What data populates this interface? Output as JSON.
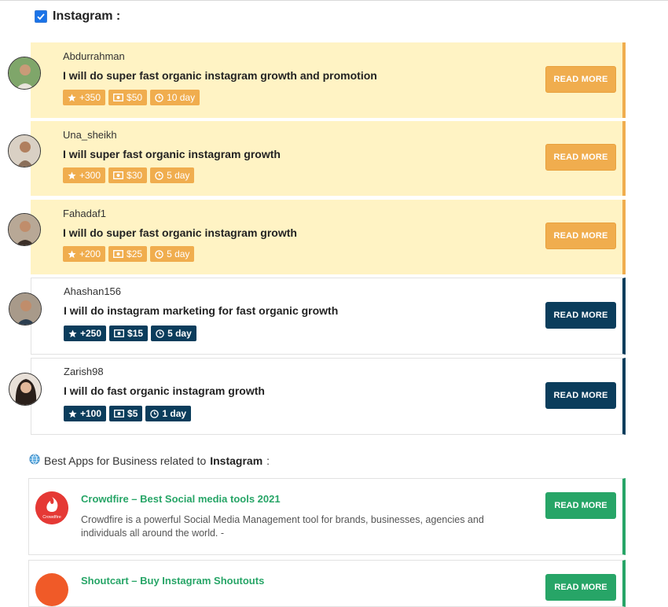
{
  "section": {
    "title": "Instagram :",
    "icon": "checkbox-icon"
  },
  "gigs": [
    {
      "username": "Abdurrahman",
      "title": "I will do super fast organic instagram growth and promotion",
      "rating": "+350",
      "price": "$50",
      "delivery": "10 day",
      "button": "READ MORE",
      "featured": true
    },
    {
      "username": "Una_sheikh",
      "title": "I will super fast organic instagram growth",
      "rating": "+300",
      "price": "$30",
      "delivery": "5 day",
      "button": "READ MORE",
      "featured": true
    },
    {
      "username": "Fahadaf1",
      "title": "I will do super fast organic instagram growth",
      "rating": "+200",
      "price": "$25",
      "delivery": "5 day",
      "button": "READ MORE",
      "featured": true
    },
    {
      "username": "Ahashan156",
      "title": "I will do instagram marketing for fast organic growth",
      "rating": "+250",
      "price": "$15",
      "delivery": "5 day",
      "button": "READ MORE",
      "featured": false
    },
    {
      "username": "Zarish98",
      "title": "I will do fast organic instagram growth",
      "rating": "+100",
      "price": "$5",
      "delivery": "1 day",
      "button": "READ MORE",
      "featured": false
    }
  ],
  "apps": {
    "heading_prefix": "Best Apps for Business related to",
    "heading_topic": "Instagram",
    "heading_suffix": ":",
    "items": [
      {
        "title": "Crowdfire – Best Social media tools 2021",
        "logo_text": "Crowdfire",
        "description": "Crowdfire is a powerful Social Media Management tool for brands, businesses, agencies and individuals all around the world. -",
        "button": "READ MORE"
      },
      {
        "title": "Shoutcart – Buy Instagram Shoutouts",
        "button": "READ MORE"
      }
    ]
  },
  "colors": {
    "featured_bg": "#fff3c4",
    "featured_accent": "#f0ad4e",
    "normal_accent": "#0b3d5c",
    "app_accent": "#27a567",
    "checkbox": "#1a73e8"
  }
}
